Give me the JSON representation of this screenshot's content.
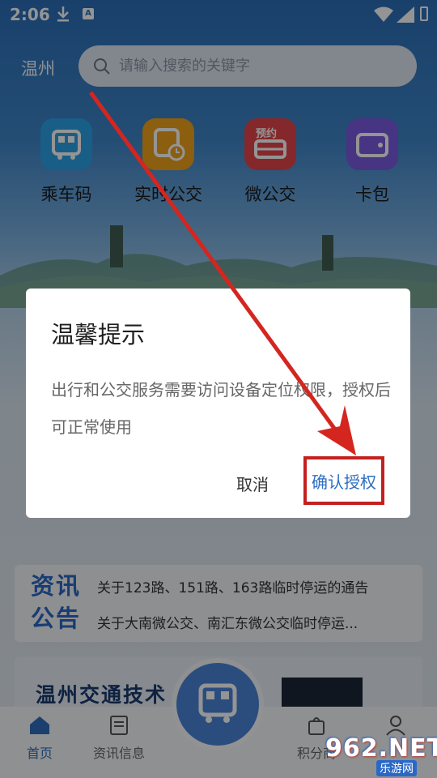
{
  "status_bar": {
    "time": "2:06",
    "icons": [
      "download-icon",
      "a-icon",
      "wifi-icon",
      "signal-icon",
      "battery-icon"
    ],
    "a_glyph": "A"
  },
  "header": {
    "city": "温州",
    "search_placeholder": "请输入搜索的关键字"
  },
  "quick_actions": [
    {
      "label": "乘车码",
      "icon": "bus-qr-icon",
      "color": "#2aa3e8"
    },
    {
      "label": "实时公交",
      "icon": "realtime-bus-icon",
      "color": "#f0a21c"
    },
    {
      "label": "微公交",
      "icon": "micro-bus-icon",
      "color": "#e6464a",
      "badge": "预约"
    },
    {
      "label": "卡包",
      "icon": "wallet-icon",
      "color": "#7b5be0"
    }
  ],
  "notice": {
    "brand_line1": "资讯",
    "brand_line2": "公告",
    "items": [
      "关于123路、151路、163路临时停运的通告",
      "关于大南微公交、南汇东微公交临时停运..."
    ]
  },
  "banner": {
    "title": "温州交通技术"
  },
  "tabs": [
    {
      "label": "首页",
      "icon": "home-icon",
      "active": true
    },
    {
      "label": "资讯信息",
      "icon": "news-icon",
      "active": false
    },
    {
      "label": "积分商",
      "icon": "shop-icon",
      "active": false
    },
    {
      "label": "",
      "icon": "profile-icon",
      "active": false
    }
  ],
  "dialog": {
    "title": "温馨提示",
    "message": "出行和公交服务需要访问设备定位权限，授权后可正常使用",
    "cancel_label": "取消",
    "confirm_label": "确认授权",
    "highlight_color": "#c3211f"
  },
  "watermark": {
    "text": "962.NET",
    "sub": "乐游网"
  }
}
